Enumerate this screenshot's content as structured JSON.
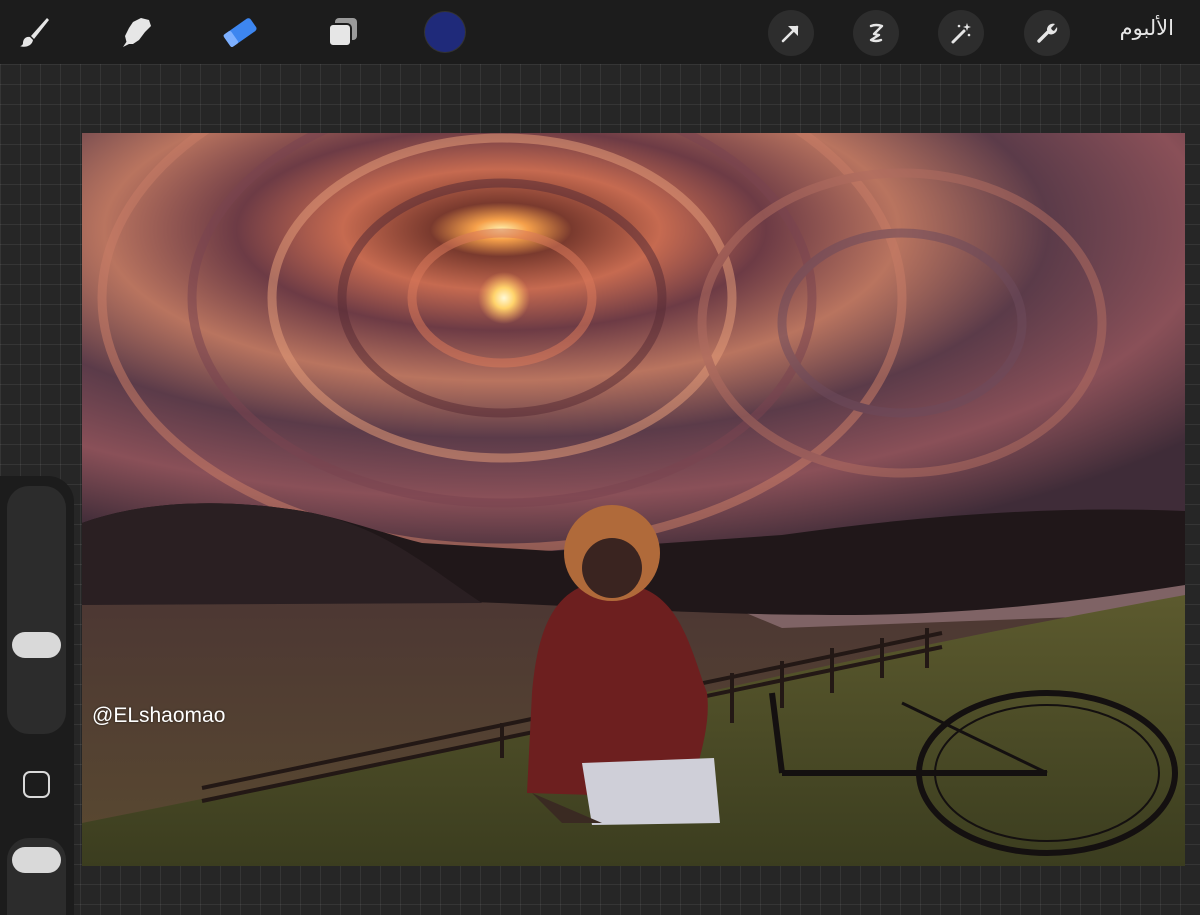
{
  "toolbar": {
    "tools": [
      {
        "name": "brush",
        "icon": "brush-icon",
        "active": false
      },
      {
        "name": "smudge",
        "icon": "smudge-icon",
        "active": false
      },
      {
        "name": "eraser",
        "icon": "eraser-icon",
        "active": true
      },
      {
        "name": "layers",
        "icon": "layers-icon",
        "active": false
      }
    ],
    "active_color": "#1f2a7a",
    "accent_color": "#3d86f0",
    "action_buttons": [
      {
        "icon": "wrench-icon",
        "label": "actions"
      },
      {
        "icon": "magic-wand-icon",
        "label": "adjustments"
      },
      {
        "icon": "selection-icon",
        "label": "selection"
      },
      {
        "icon": "cursor-arrow-icon",
        "label": "transform"
      }
    ],
    "gallery_label": "الألبوم"
  },
  "canvas": {
    "artwork": "painted-landscape",
    "watermark": "@ELshaomao"
  },
  "sidebar": {
    "size_slider_level": 0.33,
    "opacity_slider_level": 0.5,
    "modify_button_icon": "square-icon"
  }
}
